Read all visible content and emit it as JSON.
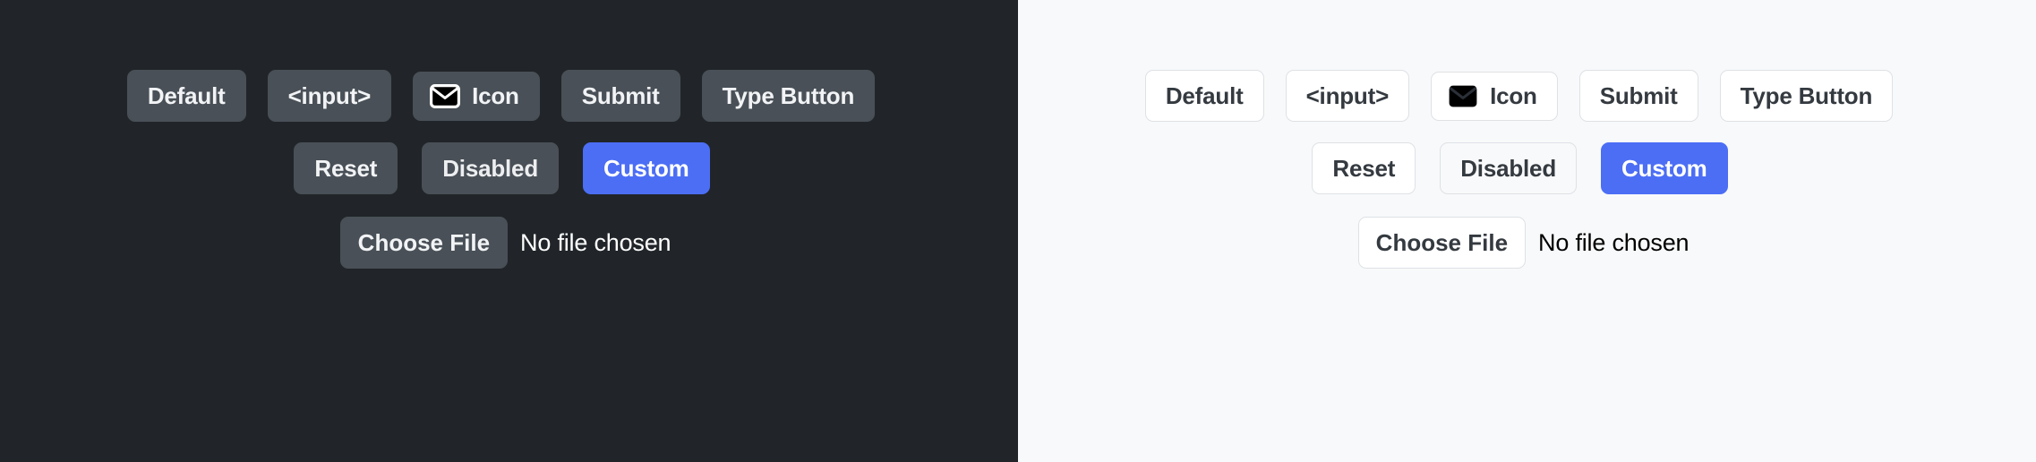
{
  "panels": [
    {
      "id": "dark-theme-panel",
      "theme": "dark",
      "background": "#212529",
      "button_background": "#495057",
      "text_color": "#f1f3f5",
      "accent": "#4c6ef5",
      "rows": [
        {
          "id": "row-primary",
          "buttons": [
            {
              "name": "default",
              "label": "Default",
              "variant": "default"
            },
            {
              "name": "input",
              "label": "<input>",
              "variant": "default"
            },
            {
              "name": "icon",
              "label": "Icon",
              "variant": "icon",
              "icon": "envelope-icon"
            },
            {
              "name": "submit",
              "label": "Submit",
              "variant": "default"
            },
            {
              "name": "type-button",
              "label": "Type Button",
              "variant": "default"
            }
          ]
        },
        {
          "id": "row-secondary",
          "buttons": [
            {
              "name": "reset",
              "label": "Reset",
              "variant": "default"
            },
            {
              "name": "disabled",
              "label": "Disabled",
              "variant": "disabled"
            },
            {
              "name": "custom",
              "label": "Custom",
              "variant": "custom"
            }
          ]
        }
      ],
      "file_input": {
        "button_label": "Choose File",
        "status_label": "No file chosen"
      }
    },
    {
      "id": "light-theme-panel",
      "theme": "light",
      "background": "#f8f9fa",
      "button_background": "#ffffff",
      "border_color": "#dee2e6",
      "text_color": "#343a40",
      "accent": "#4c6ef5",
      "rows": [
        {
          "id": "row-primary",
          "buttons": [
            {
              "name": "default",
              "label": "Default",
              "variant": "default"
            },
            {
              "name": "input",
              "label": "<input>",
              "variant": "default"
            },
            {
              "name": "icon",
              "label": "Icon",
              "variant": "icon",
              "icon": "envelope-icon"
            },
            {
              "name": "submit",
              "label": "Submit",
              "variant": "default"
            },
            {
              "name": "type-button",
              "label": "Type Button",
              "variant": "default"
            }
          ]
        },
        {
          "id": "row-secondary",
          "buttons": [
            {
              "name": "reset",
              "label": "Reset",
              "variant": "default"
            },
            {
              "name": "disabled",
              "label": "Disabled",
              "variant": "disabled"
            },
            {
              "name": "custom",
              "label": "Custom",
              "variant": "custom"
            }
          ]
        }
      ],
      "file_input": {
        "button_label": "Choose File",
        "status_label": "No file chosen"
      }
    }
  ]
}
